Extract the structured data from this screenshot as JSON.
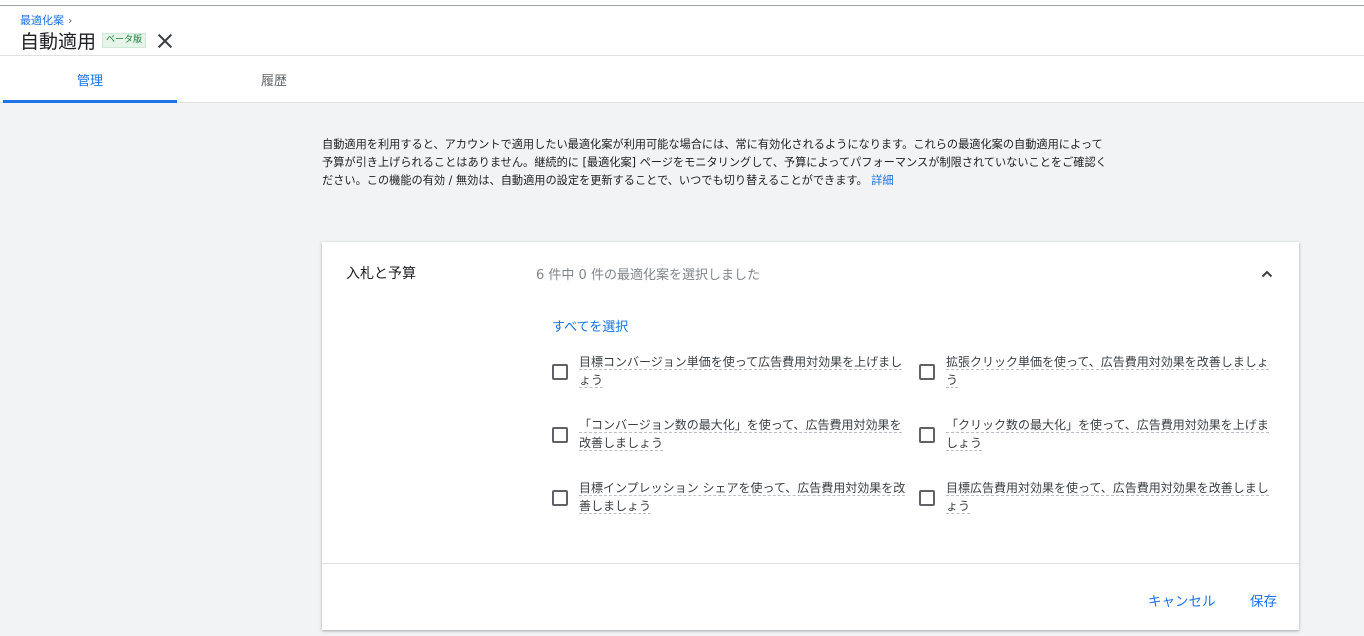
{
  "breadcrumb": {
    "label": "最適化案"
  },
  "header": {
    "title": "自動適用",
    "beta_badge": "ベータ版"
  },
  "tabs": [
    {
      "label": "管理"
    },
    {
      "label": "履歴"
    }
  ],
  "description": {
    "text": "自動適用を利用すると、アカウントで適用したい最適化案が利用可能な場合には、常に有効化されるようになります。これらの最適化案の自動適用によって予算が引き上げられることはありません。継続的に [最適化案] ページをモニタリングして、予算によってパフォーマンスが制限されていないことをご確認ください。この機能の有効 / 無効は、自動適用の設定を更新することで、いつでも切り替えることができます。",
    "link": "詳細"
  },
  "card": {
    "label": "入札と予算",
    "summary": "6 件中 0 件の最適化案を選択しました",
    "select_all": "すべてを選択",
    "options": [
      {
        "label": "目標コンバージョン単価を使って広告費用対効果を上げましょう",
        "checked": false
      },
      {
        "label": "拡張クリック単価を使って、広告費用対効果を改善しましょう",
        "checked": false
      },
      {
        "label": "「コンバージョン数の最大化」を使って、広告費用対効果を改善しましょう",
        "checked": false
      },
      {
        "label": "「クリック数の最大化」を使って、広告費用対効果を上げましょう",
        "checked": false
      },
      {
        "label": "目標インプレッション シェアを使って、広告費用対効果を改善しましょう",
        "checked": false
      },
      {
        "label": "目標広告費用対効果を使って、広告費用対効果を改善しましょう",
        "checked": false
      }
    ],
    "cancel": "キャンセル",
    "save": "保存"
  },
  "colors": {
    "accent": "#1a73e8",
    "background": "#f1f3f4",
    "beta": "#188038"
  }
}
